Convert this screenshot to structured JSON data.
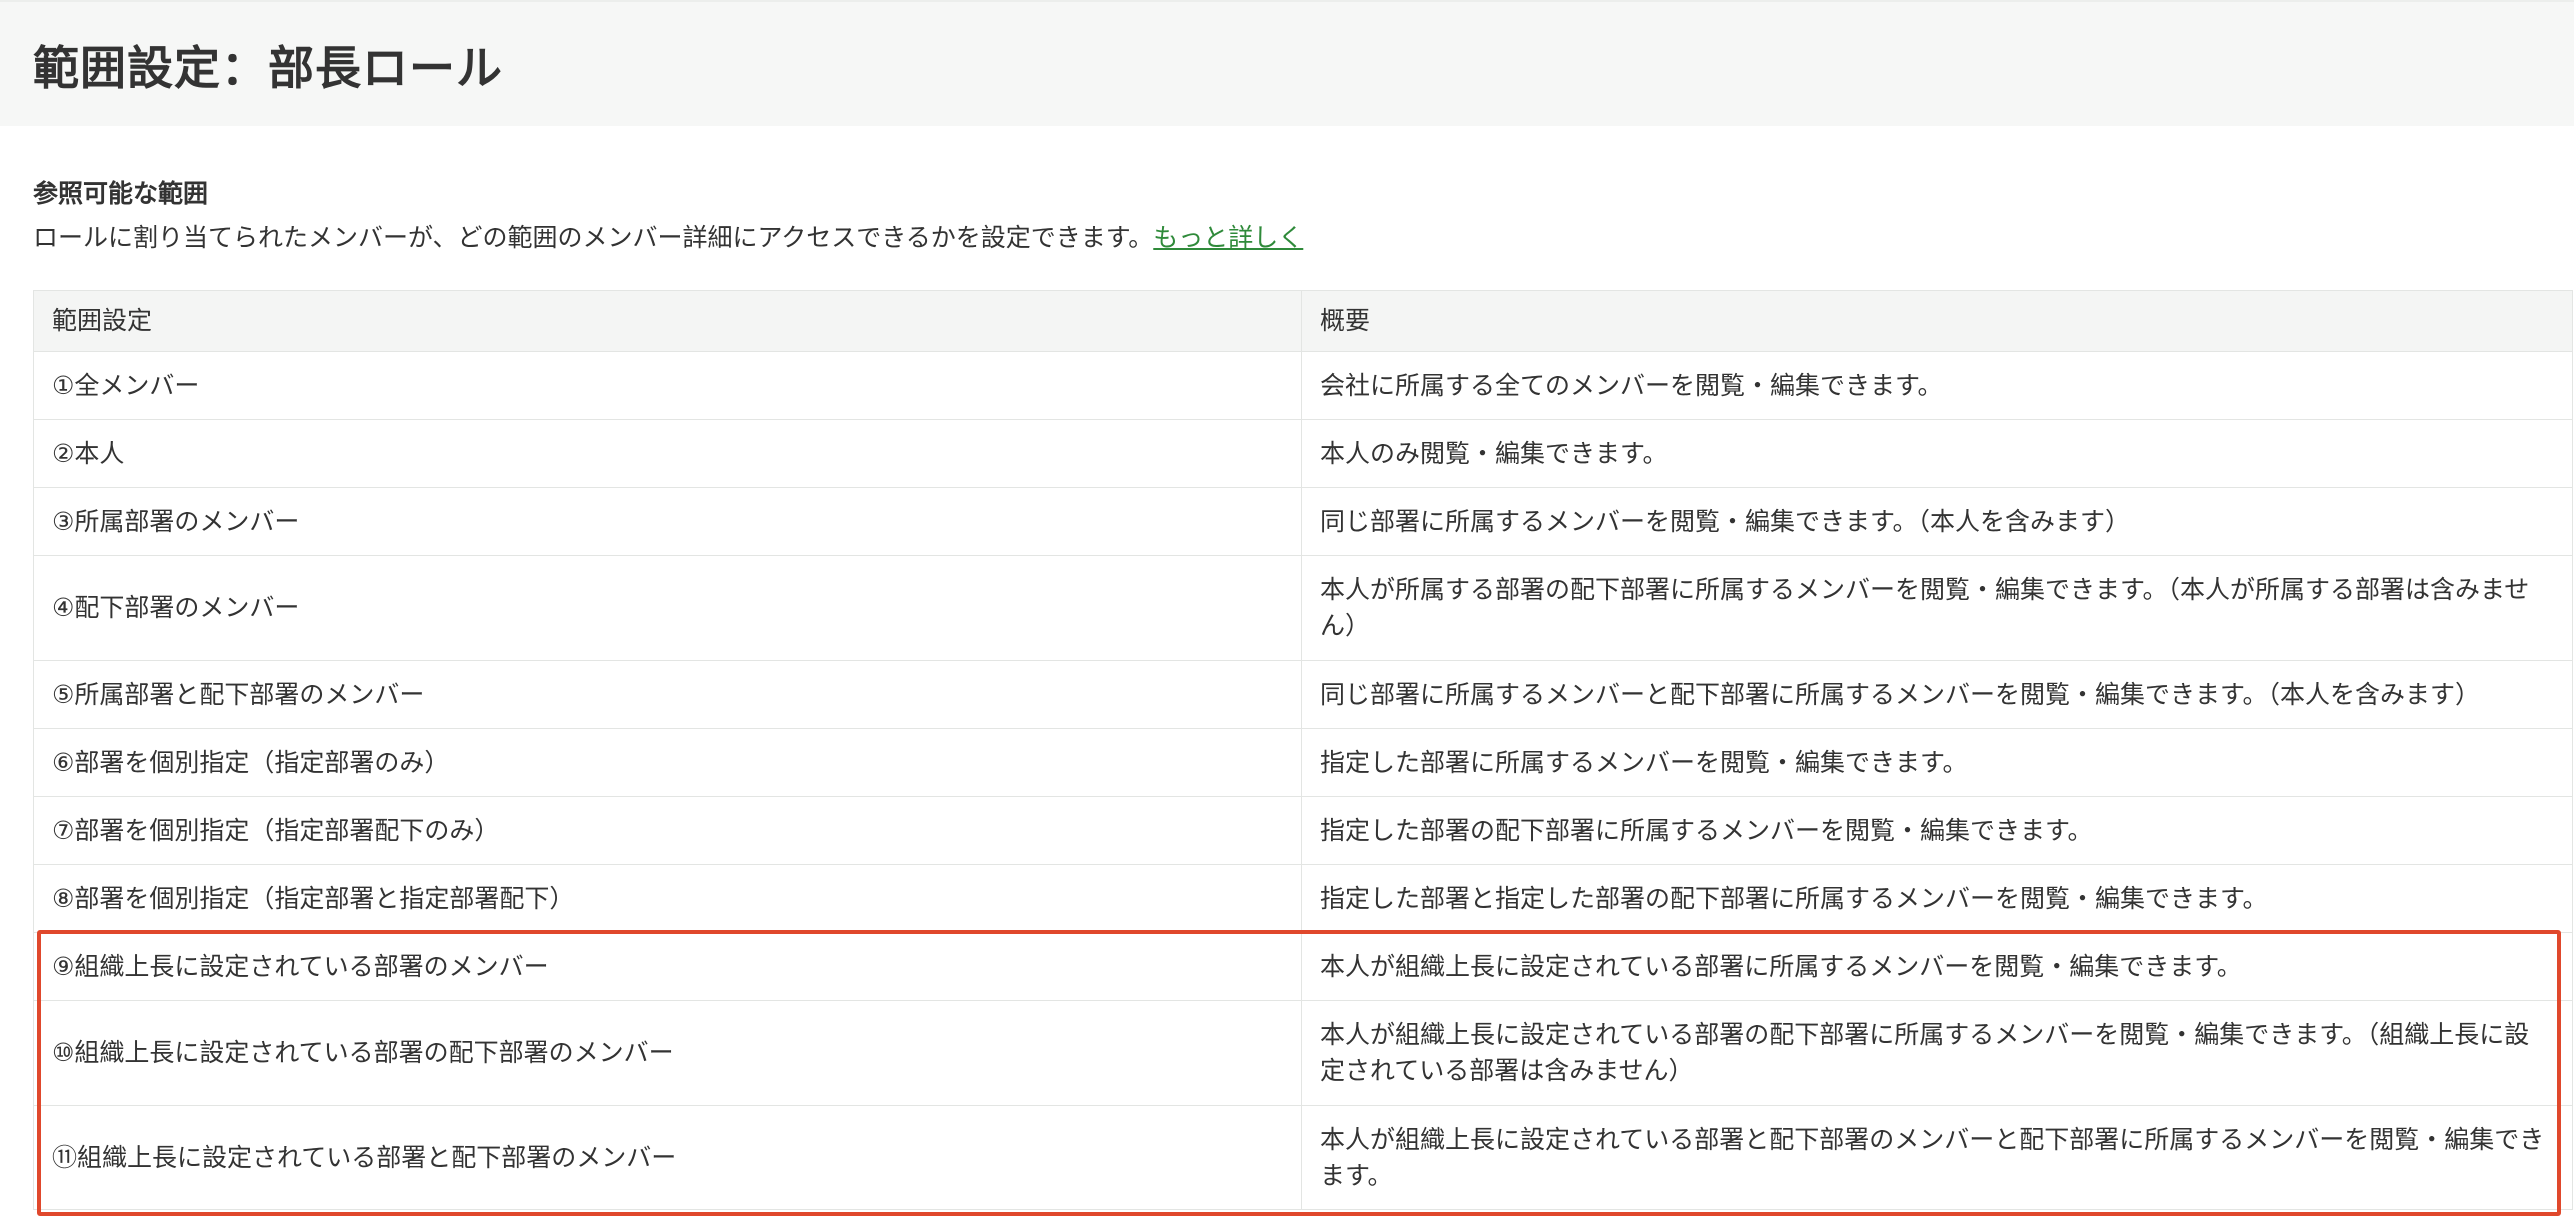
{
  "header": {
    "title": "範囲設定：部長ロール"
  },
  "section": {
    "title": "参照可能な範囲",
    "description": "ロールに割り当てられたメンバーが、どの範囲のメンバー詳細にアクセスできるかを設定できます。",
    "link_label": "もっと詳しく"
  },
  "table": {
    "columns": [
      "範囲設定",
      "概要"
    ],
    "rows": [
      {
        "scope": "①全メンバー",
        "summary": "会社に所属する全てのメンバーを閲覧・編集できます。"
      },
      {
        "scope": "②本人",
        "summary": "本人のみ閲覧・編集できます。"
      },
      {
        "scope": "③所属部署のメンバー",
        "summary": "同じ部署に所属するメンバーを閲覧・編集できます。（本人を含みます）"
      },
      {
        "scope": "④配下部署のメンバー",
        "summary": "本人が所属する部署の配下部署に所属するメンバーを閲覧・編集できます。（本人が所属する部署は含みません）"
      },
      {
        "scope": "⑤所属部署と配下部署のメンバー",
        "summary": "同じ部署に所属するメンバーと配下部署に所属するメンバーを閲覧・編集できます。（本人を含みます）"
      },
      {
        "scope": "⑥部署を個別指定（指定部署のみ）",
        "summary": "指定した部署に所属するメンバーを閲覧・編集できます。"
      },
      {
        "scope": "⑦部署を個別指定（指定部署配下のみ）",
        "summary": "指定した部署の配下部署に所属するメンバーを閲覧・編集できます。"
      },
      {
        "scope": "⑧部署を個別指定（指定部署と指定部署配下）",
        "summary": "指定した部署と指定した部署の配下部署に所属するメンバーを閲覧・編集できます。"
      },
      {
        "scope": "⑨組織上長に設定されている部署のメンバー",
        "summary": "本人が組織上長に設定されている部署に所属するメンバーを閲覧・編集できます。"
      },
      {
        "scope": "⑩組織上長に設定されている部署の配下部署のメンバー",
        "summary": "本人が組織上長に設定されている部署の配下部署に所属するメンバーを閲覧・編集できます。（組織上長に設定されている部署は含みません）"
      },
      {
        "scope": "⑪組織上長に設定されている部署と配下部署のメンバー",
        "summary": "本人が組織上長に設定されている部署と配下部署のメンバーと配下部署に所属するメンバーを閲覧・編集できます。"
      }
    ]
  },
  "colors": {
    "highlight": "#e0482c",
    "link": "#2f8a3a"
  }
}
